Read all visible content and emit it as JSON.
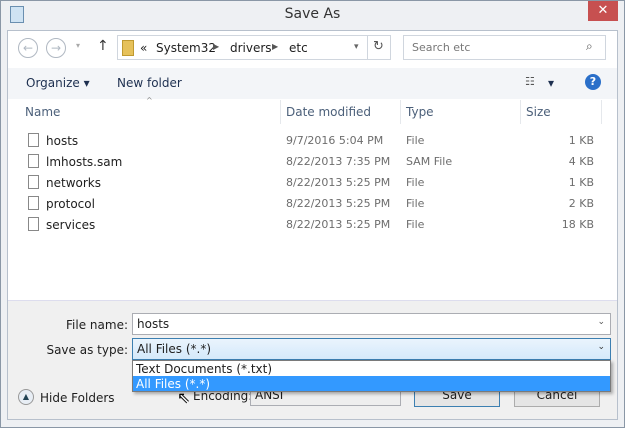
{
  "window": {
    "title": "Save As",
    "close": "✕"
  },
  "nav": {
    "back": "←",
    "forward": "→",
    "up": "↑",
    "breadcrumb": [
      "«",
      "System32",
      "drivers",
      "etc"
    ],
    "refresh": "↻",
    "search_placeholder": "Search etc"
  },
  "toolbar": {
    "organize": "Organize ▾",
    "new_folder": "New folder",
    "view": "▾",
    "help": "?"
  },
  "columns": [
    "Name",
    "Date modified",
    "Type",
    "Size"
  ],
  "files": [
    {
      "name": "hosts",
      "date": "9/7/2016 5:04 PM",
      "type": "File",
      "size": "1 KB"
    },
    {
      "name": "lmhosts.sam",
      "date": "8/22/2013 7:35 PM",
      "type": "SAM File",
      "size": "4 KB"
    },
    {
      "name": "networks",
      "date": "8/22/2013 5:25 PM",
      "type": "File",
      "size": "1 KB"
    },
    {
      "name": "protocol",
      "date": "8/22/2013 5:25 PM",
      "type": "File",
      "size": "2 KB"
    },
    {
      "name": "services",
      "date": "8/22/2013 5:25 PM",
      "type": "File",
      "size": "18 KB"
    }
  ],
  "form": {
    "file_name_label": "File name:",
    "file_name": "hosts",
    "type_label": "Save as type:",
    "type_value": "All Files  (*.*)",
    "type_options": [
      "Text Documents (*.txt)",
      "All Files  (*.*)"
    ],
    "encoding_label": "Encoding:",
    "encoding": "ANSI"
  },
  "buttons": {
    "hide_folders": "Hide Folders",
    "save": "Save",
    "cancel": "Cancel"
  }
}
